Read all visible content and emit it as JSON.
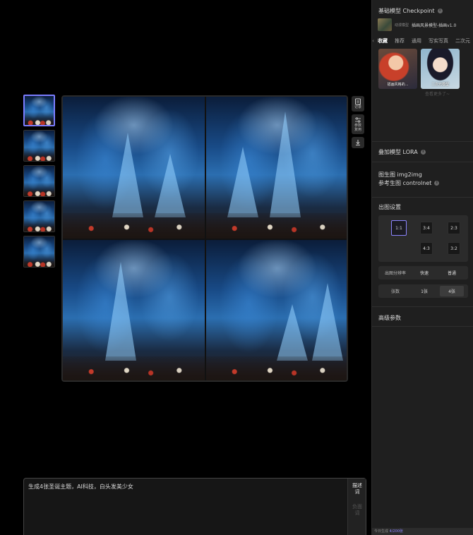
{
  "thumbnails": [
    {
      "active": true
    },
    {
      "active": false
    },
    {
      "active": false
    },
    {
      "active": false
    },
    {
      "active": false
    }
  ],
  "tools": {
    "record": "记录",
    "params": "参数复用",
    "download_icon": "download-icon"
  },
  "prompt": {
    "text": "生成4张圣诞主题，AI科技，白头发美少女",
    "tab_desc": "描述词",
    "tab_negative": "负面词"
  },
  "panel": {
    "checkpoint": {
      "title": "基础模型 Checkpoint",
      "badge": "动漫模型",
      "name": "插画风景模型-插画v1.0"
    },
    "tabs": [
      "收藏",
      "推荐",
      "通用",
      "写实写真",
      "二次元"
    ],
    "models": [
      {
        "label": "插画风格的..."
      },
      {
        "label": "二次元模型"
      }
    ],
    "view_more": "查看更多了~",
    "lora_title": "叠加模型 LORA",
    "img2img_title": "图生图 img2img",
    "controlnet_title": "参考生图 controlnet",
    "output_title": "出图设置",
    "ratios": [
      "1:1",
      "3:4",
      "2:3",
      "4:3",
      "3:2"
    ],
    "selected_ratio": "1:1",
    "resolution": {
      "label": "出图分辨率",
      "options": [
        "快速",
        "普通"
      ],
      "selected": "普通"
    },
    "count": {
      "label": "张数",
      "options": [
        "1张",
        "4张"
      ],
      "selected": "4张"
    },
    "advanced_title": "高级参数",
    "footer": {
      "prefix": "今日生成",
      "count": "4",
      "total": "/200张"
    }
  },
  "colors": {
    "accent": "#8c85ff",
    "panel_bg": "#1f1f1f",
    "canvas_bg": "#000000"
  }
}
